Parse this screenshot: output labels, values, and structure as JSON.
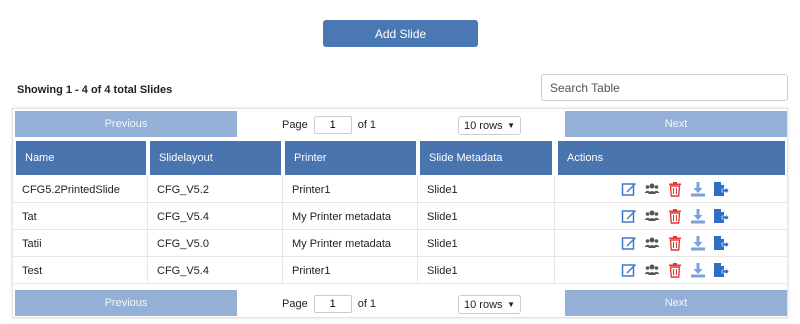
{
  "add_slide_label": "Add Slide",
  "summary": "Showing 1 - 4 of 4 total Slides",
  "search": {
    "placeholder": "Search Table"
  },
  "pagination": {
    "previous": "Previous",
    "next": "Next",
    "page_label": "Page",
    "page_value": "1",
    "of_label": "of 1",
    "rows_label": "10 rows"
  },
  "columns": [
    "Name",
    "Slidelayout",
    "Printer",
    "Slide Metadata",
    "Actions"
  ],
  "rows": [
    {
      "name": "CFG5.2PrintedSlide",
      "layout": "CFG_V5.2",
      "printer": "Printer1",
      "metadata": "Slide1"
    },
    {
      "name": "Tat",
      "layout": "CFG_V5.4",
      "printer": "My Printer metadata",
      "metadata": "Slide1"
    },
    {
      "name": "Tatii",
      "layout": "CFG_V5.0",
      "printer": "My Printer metadata",
      "metadata": "Slide1"
    },
    {
      "name": "Test",
      "layout": "CFG_V5.4",
      "printer": "Printer1",
      "metadata": "Slide1"
    }
  ],
  "action_icons": [
    "edit-icon",
    "users-icon",
    "trash-icon",
    "download-icon",
    "export-icon"
  ],
  "colors": {
    "primary": "#4a78b5",
    "header": "#4a74ad",
    "disabled_button": "#95b0d6",
    "danger": "#e03a3a",
    "icon_blue": "#3c7ac9",
    "icon_gray": "#555555"
  }
}
